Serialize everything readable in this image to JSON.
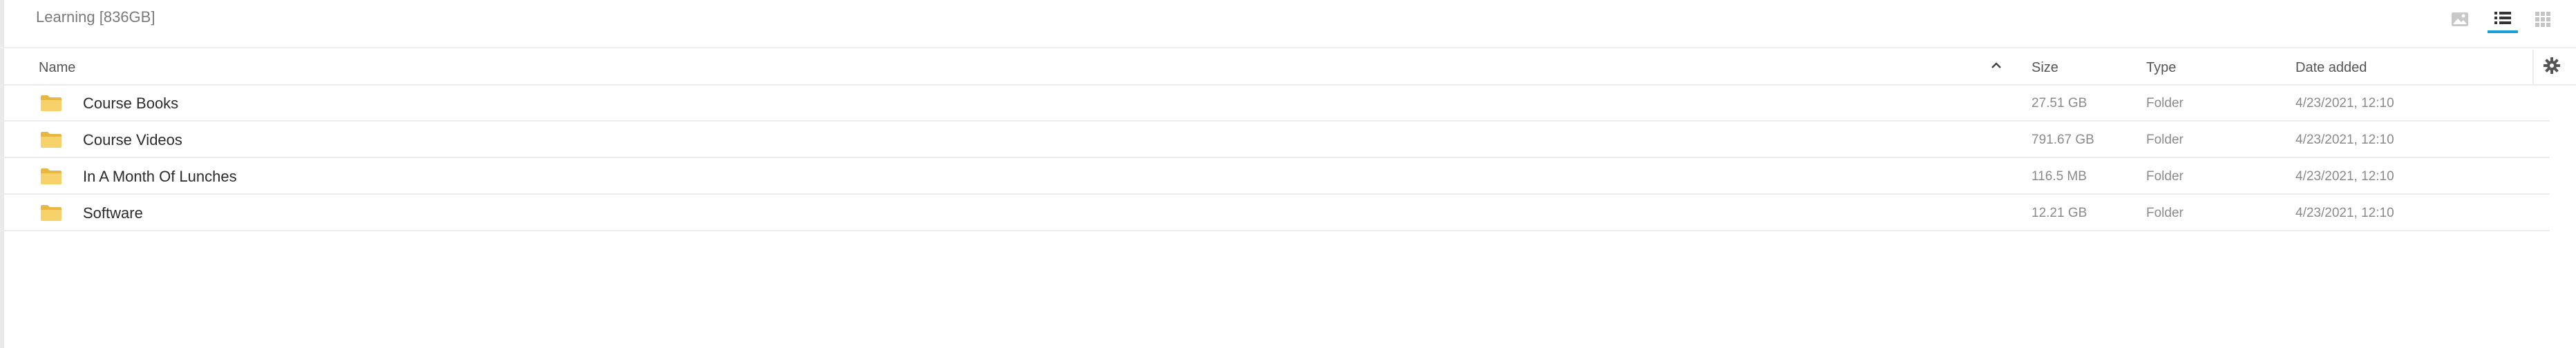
{
  "header": {
    "title": "Learning [836GB]",
    "views": [
      {
        "name": "gallery",
        "icon": "image-icon",
        "active": false
      },
      {
        "name": "list",
        "icon": "list-icon",
        "active": true
      },
      {
        "name": "grid",
        "icon": "grid-icon",
        "active": false
      }
    ]
  },
  "columns": {
    "name": "Name",
    "size": "Size",
    "type": "Type",
    "date": "Date added",
    "sort_icon": "chevron-up-icon",
    "settings_icon": "gear-icon"
  },
  "rows": [
    {
      "name": "Course Books",
      "size": "27.51 GB",
      "type": "Folder",
      "date": "4/23/2021, 12:10"
    },
    {
      "name": "Course Videos",
      "size": "791.67 GB",
      "type": "Folder",
      "date": "4/23/2021, 12:10"
    },
    {
      "name": "In A Month Of Lunches",
      "size": "116.5 MB",
      "type": "Folder",
      "date": "4/23/2021, 12:10"
    },
    {
      "name": "Software",
      "size": "12.21 GB",
      "type": "Folder",
      "date": "4/23/2021, 12:10"
    }
  ],
  "colors": {
    "accent": "#1aa0d8",
    "folder": "#f5cd5b"
  }
}
